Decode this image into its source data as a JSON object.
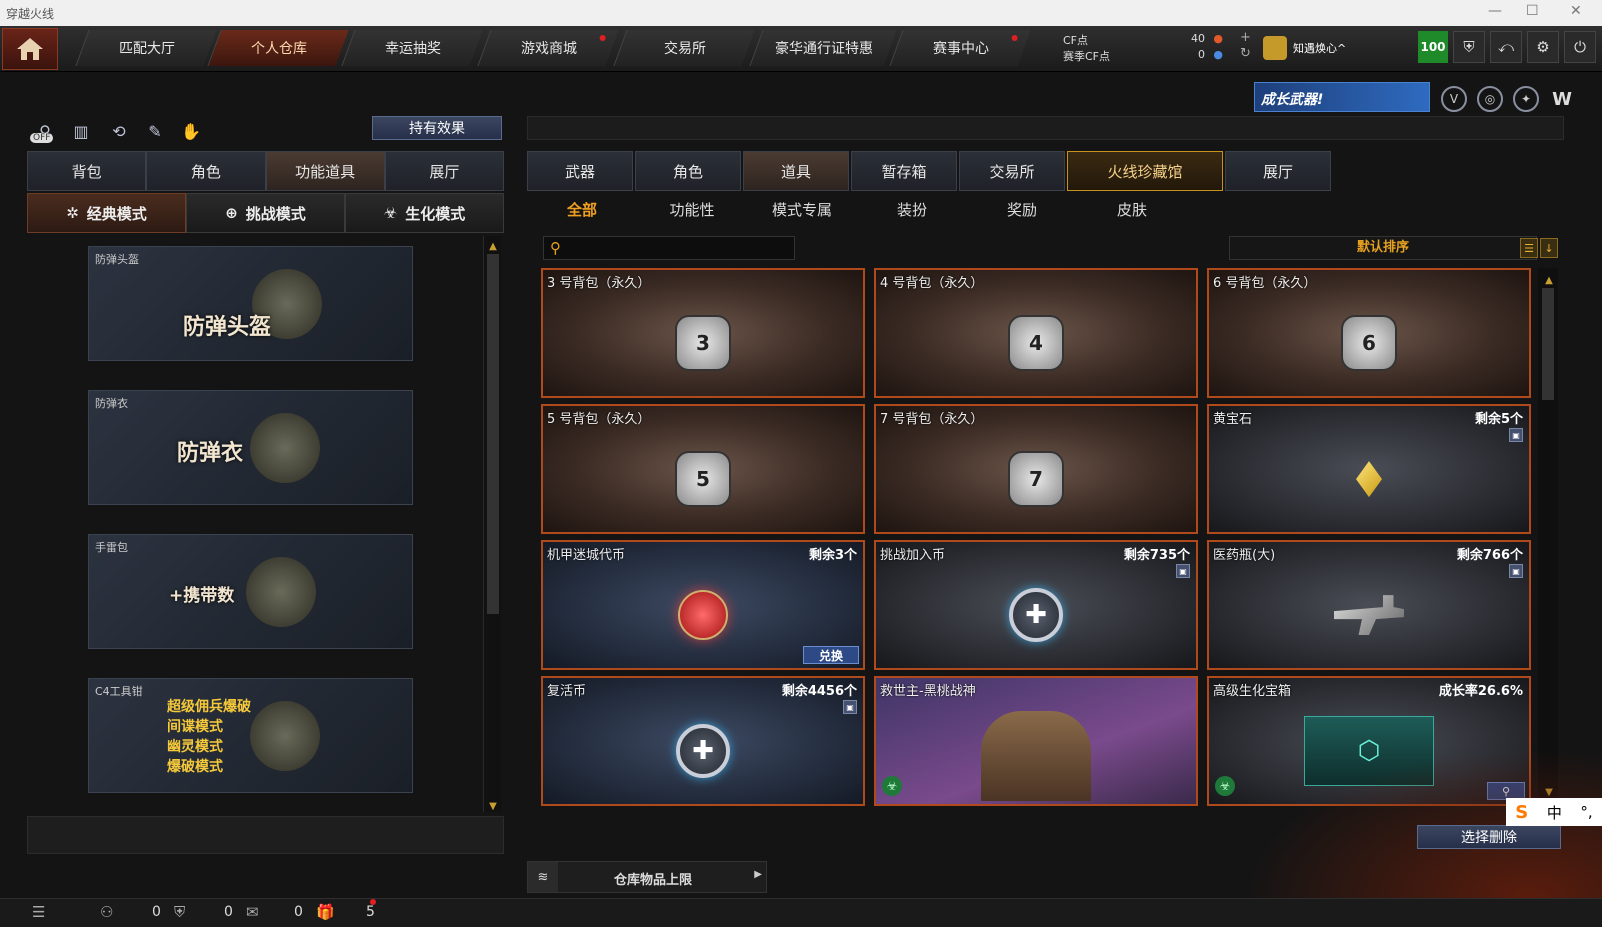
{
  "window": {
    "title": "穿越火线",
    "controls": [
      "—",
      "☐",
      "✕"
    ]
  },
  "topnav": {
    "tabs": [
      {
        "label": "匹配大厅",
        "active": false,
        "dot": false
      },
      {
        "label": "个人仓库",
        "active": true,
        "dot": false
      },
      {
        "label": "幸运抽奖",
        "active": false,
        "dot": false
      },
      {
        "label": "游戏商城",
        "active": false,
        "dot": true
      },
      {
        "label": "交易所",
        "active": false,
        "dot": false
      },
      {
        "label": "豪华通行证特惠",
        "active": false,
        "dot": false
      },
      {
        "label": "赛事中心",
        "active": false,
        "dot": true
      }
    ],
    "cf_label": "CF点",
    "cf_value": "40",
    "season_cf_label": "赛季CF点",
    "season_cf_value": "0",
    "username": "知遇焕心^",
    "level": "100",
    "icons": [
      "shield-icon",
      "return-icon",
      "gear-icon",
      "power-icon"
    ]
  },
  "banner": {
    "text": "成长武器!"
  },
  "left": {
    "effect_button": "持有效果",
    "off_label": "OFF",
    "tabs": [
      "背包",
      "角色",
      "功能道具",
      "展厅"
    ],
    "active_tab": 2,
    "modes": [
      {
        "label": "经典模式",
        "icon": "✲"
      },
      {
        "label": "挑战模式",
        "icon": "⊕"
      },
      {
        "label": "生化模式",
        "icon": "☣"
      }
    ],
    "items": [
      {
        "label": "防弹头盔",
        "big": "防弹头盔"
      },
      {
        "label": "防弹衣",
        "big": "防弹衣"
      },
      {
        "label": "手雷包",
        "big": "+携带数"
      },
      {
        "label": "C4工具钳",
        "lines": [
          "超级佣兵爆破",
          "间谍模式",
          "幽灵模式",
          "爆破模式"
        ]
      }
    ]
  },
  "right": {
    "tabs": [
      "武器",
      "角色",
      "道具",
      "暂存箱",
      "交易所",
      "火线珍藏馆",
      "展厅"
    ],
    "active_tab": 2,
    "subtabs": [
      "全部",
      "功能性",
      "模式专属",
      "装扮",
      "奖励",
      "皮肤"
    ],
    "active_subtab": 0,
    "search_placeholder": "",
    "sort_label": "默认排序",
    "items": [
      {
        "name": "3 号背包（永久）",
        "qty": "",
        "style": "brown",
        "img": "bag",
        "num": "3"
      },
      {
        "name": "4 号背包（永久）",
        "qty": "",
        "style": "brown",
        "img": "bag",
        "num": "4"
      },
      {
        "name": "6 号背包（永久）",
        "qty": "",
        "style": "brown",
        "img": "bag",
        "num": "6"
      },
      {
        "name": "5 号背包（永久）",
        "qty": "",
        "style": "brown",
        "img": "bag",
        "num": "5"
      },
      {
        "name": "7 号背包（永久）",
        "qty": "",
        "style": "brown",
        "img": "bag",
        "num": "7"
      },
      {
        "name": "黄宝石",
        "qty": "剩余5个",
        "style": "grey",
        "img": "gem",
        "lock": true
      },
      {
        "name": "机甲迷城代币",
        "qty": "剩余3个",
        "style": "blue",
        "img": "coin",
        "button": "兑换"
      },
      {
        "name": "挑战加入币",
        "qty": "剩余735个",
        "style": "grey",
        "img": "ring",
        "lock": true
      },
      {
        "name": "医药瓶(大)",
        "qty": "剩余766个",
        "style": "grey",
        "img": "gun",
        "lock": true
      },
      {
        "name": "复活币",
        "qty": "剩余4456个",
        "style": "blue",
        "img": "ring",
        "lock": true
      },
      {
        "name": "救世主-黑桃战神",
        "qty": "",
        "style": "purple",
        "img": "hero",
        "bio": true
      },
      {
        "name": "高级生化宝箱",
        "qty": "成长率26.6%",
        "style": "grey",
        "img": "chest",
        "bio": true,
        "magnify": true
      }
    ],
    "delete_button": "选择删除",
    "limit_label": "仓库物品上限"
  },
  "ime": {
    "s": "S",
    "mode": "中",
    "punct": "°,"
  },
  "statusbar": {
    "friends": "0",
    "clan": "0",
    "chat": "0",
    "gift": "5"
  }
}
